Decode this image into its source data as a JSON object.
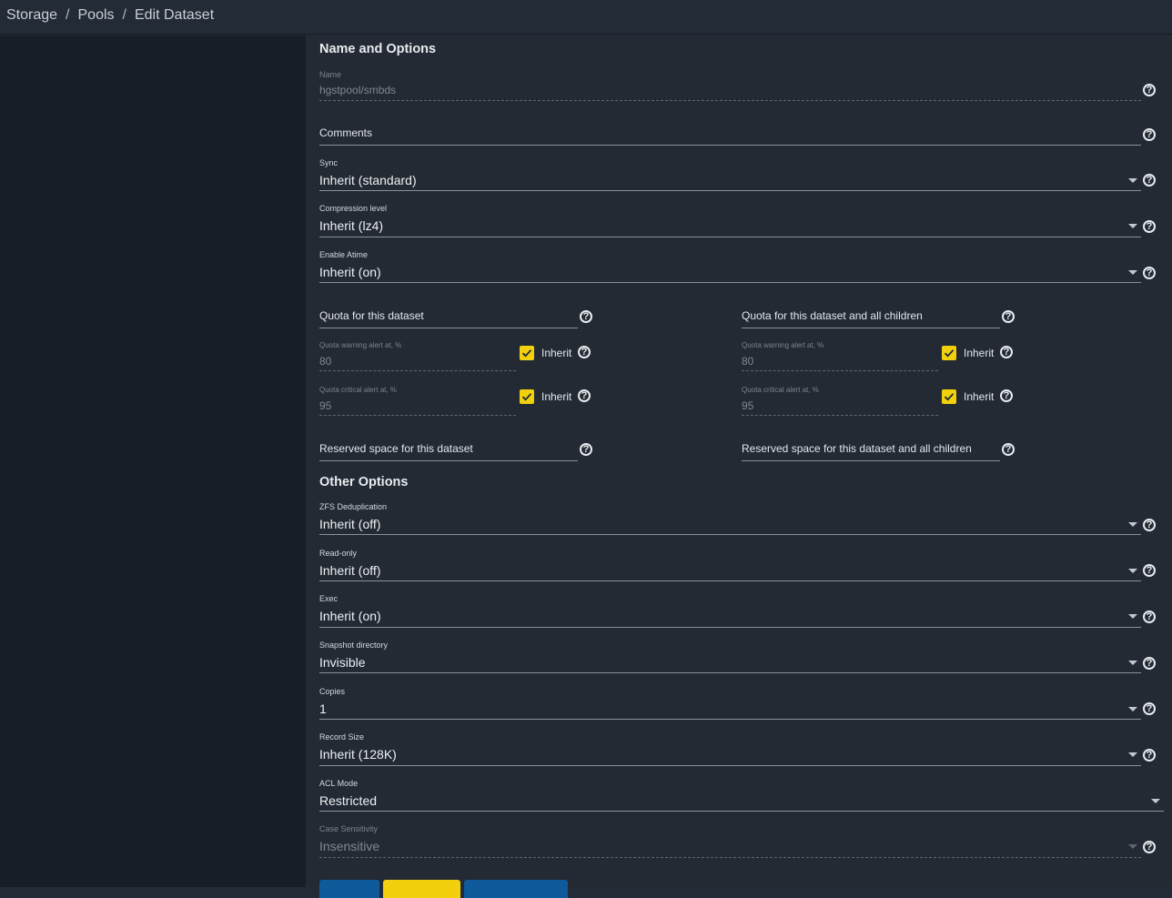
{
  "breadcrumb": [
    {
      "label": "Storage"
    },
    {
      "label": "Pools"
    },
    {
      "label": "Edit Dataset"
    }
  ],
  "breadcrumb_separator": "/",
  "sections": {
    "name_options": "Name and Options",
    "other_options": "Other Options"
  },
  "fields": {
    "name": {
      "label": "Name",
      "value": "hgstpool/smbds"
    },
    "comments": {
      "label": "Comments",
      "value": ""
    },
    "sync": {
      "label": "Sync",
      "value": "Inherit (standard)"
    },
    "compression": {
      "label": "Compression level",
      "value": "Inherit (lz4)"
    },
    "atime": {
      "label": "Enable Atime",
      "value": "Inherit (on)"
    },
    "dedup": {
      "label": "ZFS Deduplication",
      "value": "Inherit (off)"
    },
    "readonly": {
      "label": "Read-only",
      "value": "Inherit (off)"
    },
    "exec": {
      "label": "Exec",
      "value": "Inherit (on)"
    },
    "snapdir": {
      "label": "Snapshot directory",
      "value": "Invisible"
    },
    "copies": {
      "label": "Copies",
      "value": "1"
    },
    "recordsize": {
      "label": "Record Size",
      "value": "Inherit (128K)"
    },
    "aclmode": {
      "label": "ACL Mode",
      "value": "Restricted"
    },
    "casesensitivity": {
      "label": "Case Sensitivity",
      "value": "Insensitive"
    }
  },
  "quota": {
    "dataset": {
      "label": "Quota for this dataset",
      "warning_label": "Quota warning alert at, %",
      "warning_value": "80",
      "critical_label": "Quota critical alert at, %",
      "critical_value": "95",
      "inherit_label": "Inherit",
      "reserved_label": "Reserved space for this dataset"
    },
    "children": {
      "label": "Quota for this dataset and all children",
      "warning_label": "Quota warning alert at, %",
      "warning_value": "80",
      "critical_label": "Quota critical alert at, %",
      "critical_value": "95",
      "inherit_label": "Inherit",
      "reserved_label": "Reserved space for this dataset and all children"
    }
  },
  "colors": {
    "accent_yellow": "#f2d00d",
    "accent_blue": "#0e5a9a",
    "sidebar_bg": "#171e26",
    "main_bg": "#232a34"
  }
}
